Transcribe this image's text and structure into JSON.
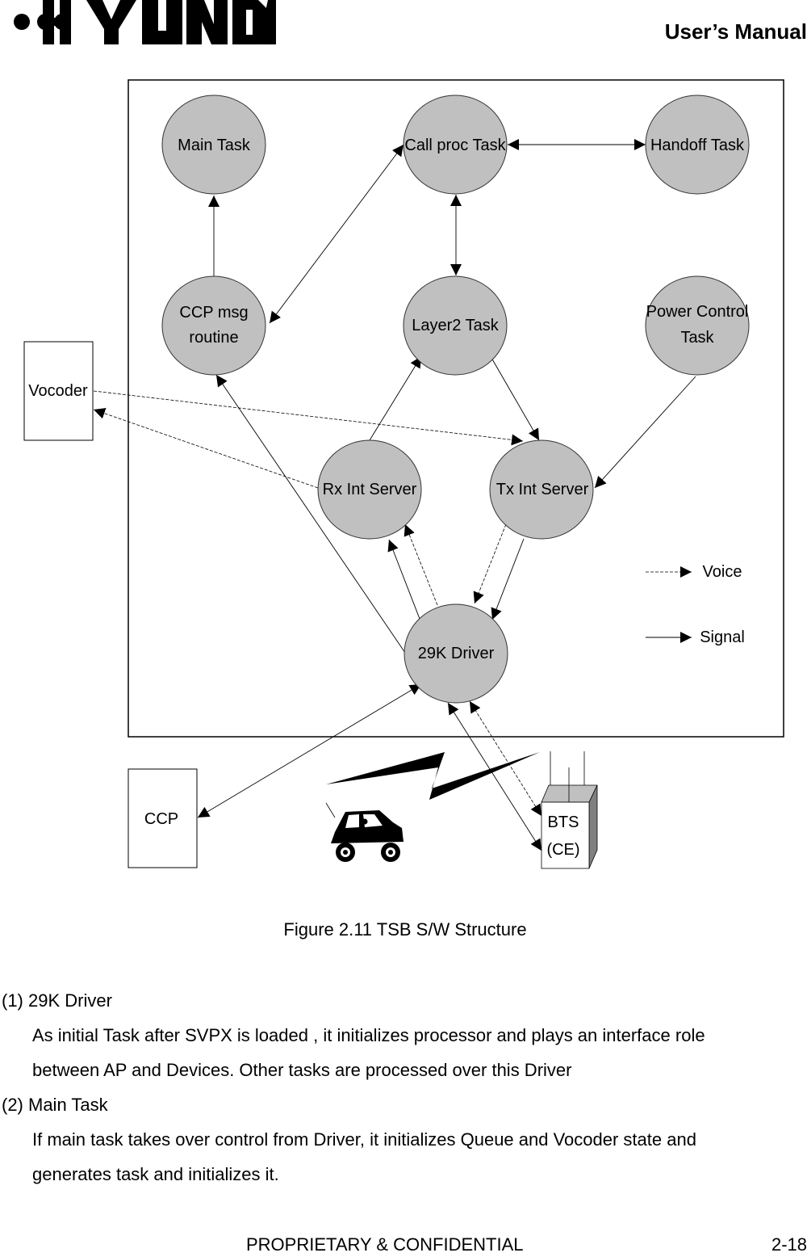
{
  "header": {
    "logo_text": "HYUNDAI",
    "manual_title": "User’s Manual"
  },
  "diagram": {
    "nodes": {
      "main_task": "Main Task",
      "call_proc_task": "Call proc Task",
      "handoff_task": "Handoff Task",
      "ccp_msg_line1": "CCP msg",
      "ccp_msg_line2": "routine",
      "layer2_task": "Layer2 Task",
      "power_control_line1": "Power Control",
      "power_control_line2": "Task",
      "rx_int_server": "Rx Int Server",
      "tx_int_server": "Tx Int Server",
      "driver_29k": "29K Driver",
      "vocoder": "Vocoder",
      "ccp": "CCP",
      "bts_line1": "BTS",
      "bts_line2": "(CE)"
    },
    "legend": {
      "voice": "Voice",
      "signal": "Signal"
    },
    "colors": {
      "node_fill": "#c0c0c0"
    }
  },
  "caption": "Figure 2.11 TSB S/W Structure",
  "sections": [
    {
      "heading": "(1) 29K Driver",
      "lines": [
        "As initial Task after SVPX is loaded , it initializes processor and plays an interface role",
        "between AP and Devices. Other tasks are processed over this Driver"
      ]
    },
    {
      "heading": "(2) Main Task",
      "lines": [
        "If main task takes over control from Driver,  it initializes Queue and Vocoder state and",
        "generates task and initializes it."
      ]
    }
  ],
  "footer": {
    "confidential": "PROPRIETARY & CONFIDENTIAL",
    "page_number": "2-18"
  }
}
